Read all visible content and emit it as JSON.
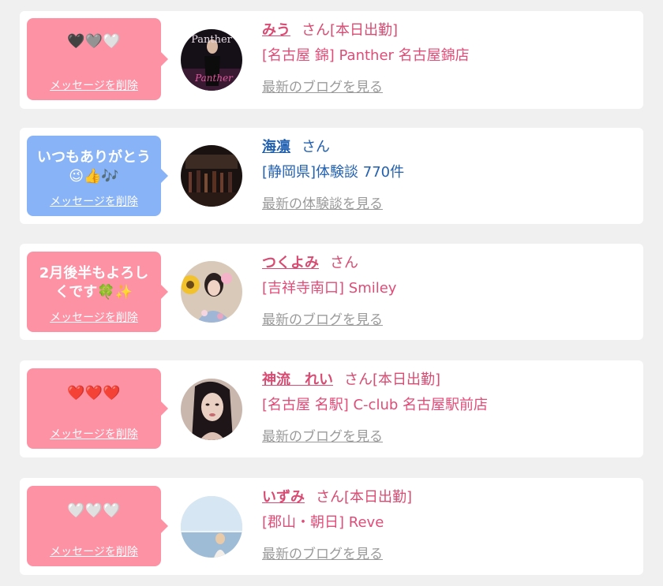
{
  "cards": [
    {
      "bubble_color": "#fd92a5",
      "message": "🖤🩶🤍",
      "delete_label": "メッセージを削除",
      "name": "みう",
      "suffix": "さん",
      "status": "[本日出勤]",
      "shop": "[名古屋 錦] Panther 名古屋錦店",
      "link": "最新のブログを見る",
      "avatar_text": "Panther"
    },
    {
      "bubble_color": "#88b3f7",
      "message_line1": "いつもありがとう",
      "message_line2": "😉👍🎶",
      "delete_label": "メッセージを削除",
      "name": "海凛",
      "suffix": "さん",
      "shop": "[静岡県]体験談 770件",
      "link": "最新の体験談を見る"
    },
    {
      "bubble_color": "#fd92a5",
      "message_line1": "2月後半もよろし",
      "message_line2": "くです🍀✨",
      "delete_label": "メッセージを削除",
      "name": "つくよみ",
      "suffix": "さん",
      "shop": "[吉祥寺南口] Smiley",
      "link": "最新のブログを見る"
    },
    {
      "bubble_color": "#fd92a5",
      "message": "❤️❤️❤️",
      "delete_label": "メッセージを削除",
      "name": "神流　れい",
      "suffix": "さん",
      "status": "[本日出勤]",
      "shop": "[名古屋 名駅] C-club 名古屋駅前店",
      "link": "最新のブログを見る"
    },
    {
      "bubble_color": "#fd92a5",
      "message": "🤍🤍🤍",
      "delete_label": "メッセージを削除",
      "name": "いずみ",
      "suffix": "さん",
      "status": "[本日出勤]",
      "shop": "[郡山・朝日] Reve",
      "link": "最新のブログを見る"
    }
  ]
}
